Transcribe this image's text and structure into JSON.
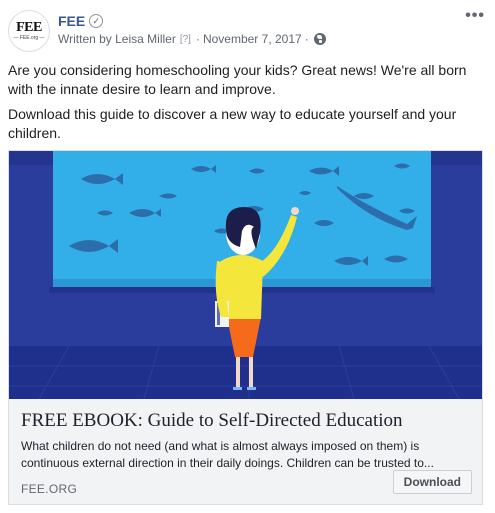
{
  "post": {
    "page_name": "FEE",
    "avatar_text": "FEE",
    "avatar_subtext": "— FEE.org —",
    "author_line": "Written by Leisa Miller",
    "help_mark": "[?]",
    "date": "November 7, 2017",
    "separator": "·",
    "message_paragraphs": [
      "Are you considering homeschooling your kids? Great news! We're all born with the innate desire to learn and improve.",
      "Download this guide to discover a new way to educate yourself and your children."
    ]
  },
  "attachment": {
    "title": "FREE EBOOK: Guide to Self-Directed Education",
    "description_line1": "What children do not need (and what is almost always imposed on them) is",
    "description_line2": "continuous external direction in their daily doings. Children can be trusted to...",
    "domain": "FEE.ORG",
    "cta_label": "Download"
  },
  "colors": {
    "link_blue": "#385898",
    "aquarium_water": "#2fa8e6",
    "aquarium_frame": "#2a3d9c",
    "floor": "#1e2f8a",
    "fish": "#2c6dab",
    "shirt": "#f4e63a",
    "skirt": "#f56a1b"
  },
  "icons": {
    "verified": "verified-badge-icon",
    "globe": "globe-icon",
    "more": "more-options-icon"
  }
}
